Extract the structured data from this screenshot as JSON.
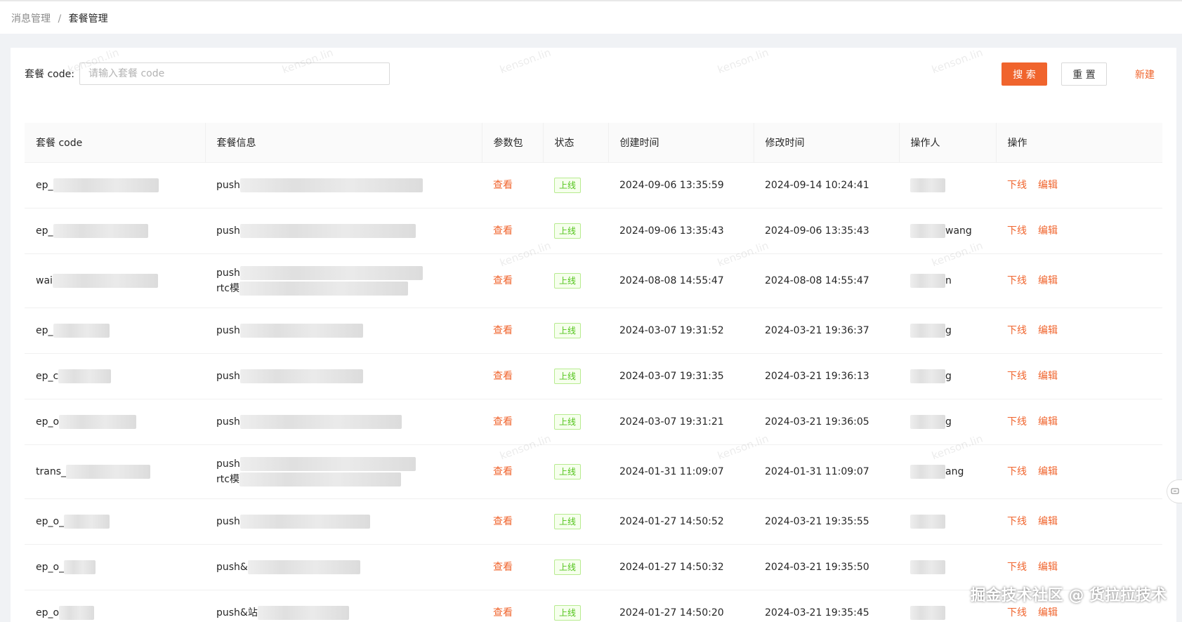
{
  "breadcrumb": {
    "parent": "消息管理",
    "separator": "/",
    "current": "套餐管理"
  },
  "search": {
    "label": "套餐 code:",
    "placeholder": "请输入套餐 code",
    "value": ""
  },
  "buttons": {
    "search": "搜 索",
    "reset": "重 置",
    "new": "新建"
  },
  "table": {
    "headers": [
      "套餐 code",
      "套餐信息",
      "参数包",
      "状态",
      "创建时间",
      "修改时间",
      "操作人",
      "操作"
    ],
    "rows": [
      {
        "code": "ep_",
        "info": "push",
        "param": "查看",
        "status": "上线",
        "created": "2024-09-06 13:35:59",
        "modified": "2024-09-14 10:24:41",
        "operator": "",
        "offline": "下线",
        "edit": "编辑"
      },
      {
        "code": "ep_",
        "info": "push",
        "param": "查看",
        "status": "上线",
        "created": "2024-09-06 13:35:43",
        "modified": "2024-09-06 13:35:43",
        "operator": "wang",
        "offline": "下线",
        "edit": "编辑"
      },
      {
        "code": "wai",
        "info": "push",
        "info2": "rtc模",
        "param": "查看",
        "status": "上线",
        "created": "2024-08-08 14:55:47",
        "modified": "2024-08-08 14:55:47",
        "operator": "n",
        "offline": "下线",
        "edit": "编辑"
      },
      {
        "code": "ep_",
        "info": "push",
        "param": "查看",
        "status": "上线",
        "created": "2024-03-07 19:31:52",
        "modified": "2024-03-21 19:36:37",
        "operator": "g",
        "offline": "下线",
        "edit": "编辑"
      },
      {
        "code": "ep_c",
        "info": "push",
        "param": "查看",
        "status": "上线",
        "created": "2024-03-07 19:31:35",
        "modified": "2024-03-21 19:36:13",
        "operator": "g",
        "offline": "下线",
        "edit": "编辑"
      },
      {
        "code": "ep_o",
        "info": "push",
        "param": "查看",
        "status": "上线",
        "created": "2024-03-07 19:31:21",
        "modified": "2024-03-21 19:36:05",
        "operator": "g",
        "offline": "下线",
        "edit": "编辑"
      },
      {
        "code": "trans_",
        "info": "push",
        "info2": "rtc模",
        "param": "查看",
        "status": "上线",
        "created": "2024-01-31 11:09:07",
        "modified": "2024-01-31 11:09:07",
        "operator": "ang",
        "offline": "下线",
        "edit": "编辑"
      },
      {
        "code": "ep_o_",
        "info": "push",
        "param": "查看",
        "status": "上线",
        "created": "2024-01-27 14:50:52",
        "modified": "2024-03-21 19:35:55",
        "operator": "",
        "offline": "下线",
        "edit": "编辑"
      },
      {
        "code": "ep_o_",
        "info": "push&",
        "param": "查看",
        "status": "上线",
        "created": "2024-01-27 14:50:32",
        "modified": "2024-03-21 19:35:50",
        "operator": "",
        "offline": "下线",
        "edit": "编辑"
      },
      {
        "code": "ep_o",
        "info": "push&站",
        "param": "查看",
        "status": "上线",
        "created": "2024-01-27 14:50:20",
        "modified": "2024-03-21 19:35:45",
        "operator": "",
        "offline": "下线",
        "edit": "编辑"
      }
    ]
  },
  "watermark_text": "kenson.lin",
  "footer_mark": "掘金技术社区 @ 货拉拉技术",
  "colors": {
    "accent": "#f0642d",
    "tag_green": "#52c41a"
  }
}
